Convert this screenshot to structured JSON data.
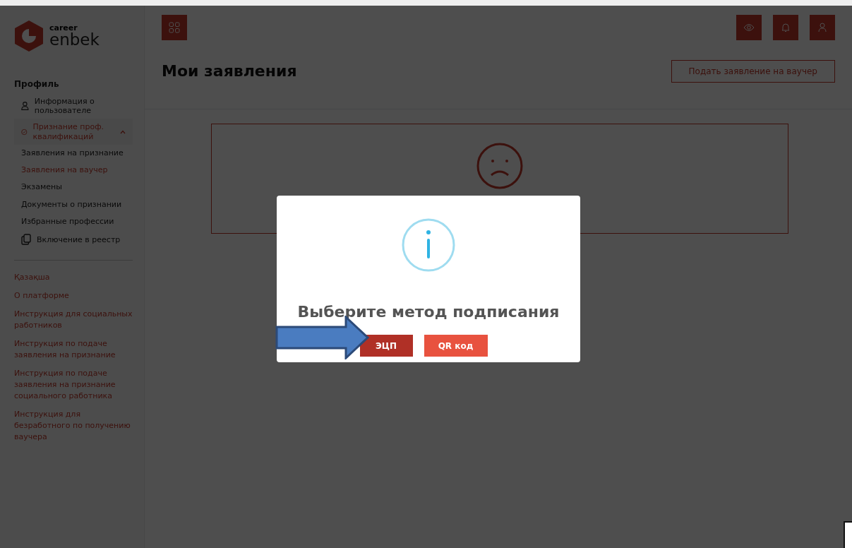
{
  "sidebar": {
    "logo": {
      "caption": "career",
      "name": "enbek"
    },
    "section_title": "Профиль",
    "items": [
      {
        "kind": "user",
        "label": "Информация о пользователе",
        "selected": false
      },
      {
        "kind": "check",
        "label": "Признание проф. квалификаций",
        "selected": true,
        "expanded": true,
        "children": [
          {
            "label": "Заявления на признание",
            "selected": false
          },
          {
            "label": "Заявления на ваучер",
            "selected": true
          },
          {
            "label": "Экзамены",
            "selected": false
          },
          {
            "label": "Документы о признании",
            "selected": false
          },
          {
            "label": "Избранные профессии",
            "selected": false
          }
        ]
      },
      {
        "kind": "copy",
        "label": "Включение в реестр",
        "selected": false
      }
    ],
    "links": [
      "Қазақша",
      "О платформе",
      "Инструкция для социальных работников",
      "Инструкция по подаче заявления на признание",
      "Инструкция по подаче заявления на признание социального работника",
      "Инструкция для безработного по получению ваучера"
    ]
  },
  "header": {
    "page_title": "Мои заявления",
    "action_button": "Подать заявление на ваучер"
  },
  "dialog": {
    "title": "Выберите метод подписания",
    "buttons": [
      {
        "label": "ЭЦП",
        "color": "#b03026"
      },
      {
        "label": "QR код",
        "color": "#e8523f"
      }
    ]
  }
}
